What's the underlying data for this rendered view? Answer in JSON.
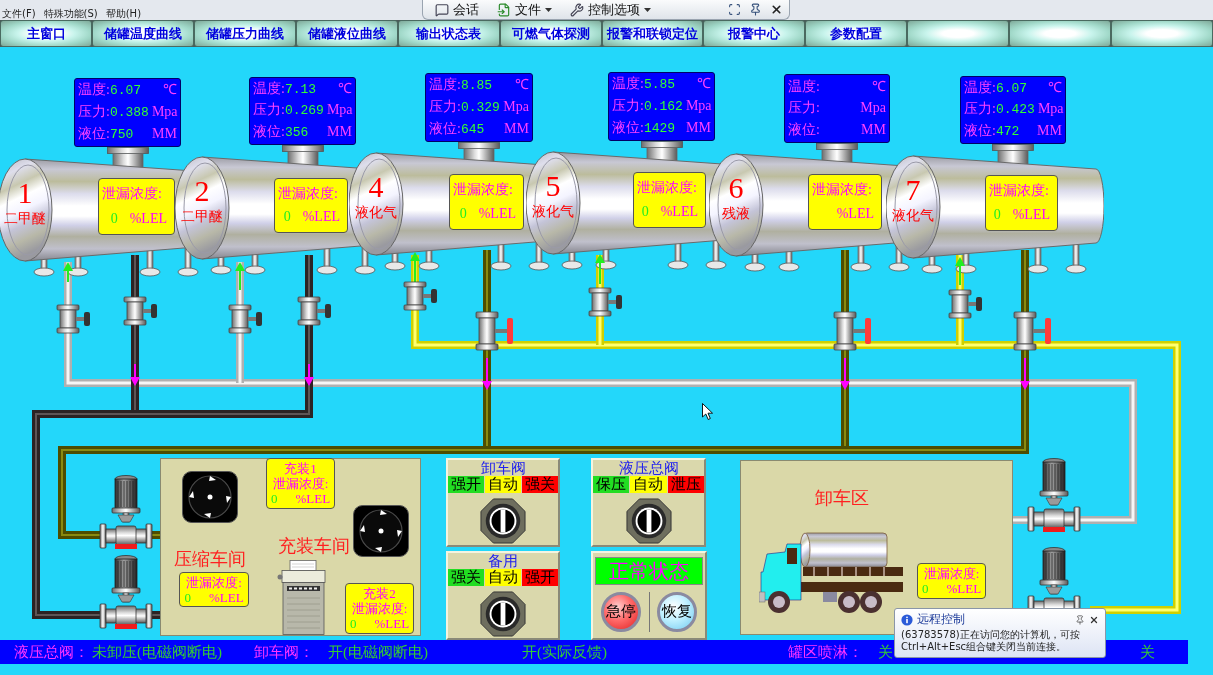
{
  "menu_bar": [
    {
      "label": "文件(F)"
    },
    {
      "label": "特殊功能(S)"
    },
    {
      "label": "帮助(H)"
    }
  ],
  "remote_toolbar": {
    "buttons": [
      {
        "kind": "chat",
        "label": "会话",
        "has_menu": false
      },
      {
        "kind": "file",
        "label": "文件",
        "has_menu": true
      },
      {
        "kind": "tools",
        "label": "控制选项",
        "has_menu": true
      }
    ]
  },
  "nav_tabs": [
    {
      "kind": "text",
      "label": "主窗口"
    },
    {
      "kind": "text",
      "label": "储罐温度曲线"
    },
    {
      "kind": "text",
      "label": "储罐压力曲线"
    },
    {
      "kind": "text",
      "label": "储罐液位曲线"
    },
    {
      "kind": "text",
      "label": "输出状态表"
    },
    {
      "kind": "text",
      "label": "可燃气体探测"
    },
    {
      "kind": "text",
      "label": "报警和联锁定位"
    },
    {
      "kind": "text",
      "label": "报警中心"
    },
    {
      "kind": "text",
      "label": "参数配置"
    },
    {
      "kind": "blank"
    },
    {
      "kind": "blank"
    },
    {
      "kind": "blank"
    }
  ],
  "tanks": [
    {
      "number": "1",
      "name": "二甲醚",
      "readings": [
        {
          "label": "温度:",
          "value": "6.07",
          "unit": "℃"
        },
        {
          "label": "压力:",
          "value": "0.388",
          "unit": "Mpa"
        },
        {
          "label": "液位:",
          "value": "750",
          "unit": "MM"
        }
      ],
      "leak": {
        "label": "泄漏浓度:",
        "value": "0",
        "unit": "%LEL"
      }
    },
    {
      "number": "2",
      "name": "二甲醚",
      "readings": [
        {
          "label": "温度:",
          "value": "7.13",
          "unit": "℃"
        },
        {
          "label": "压力:",
          "value": "0.269",
          "unit": "Mpa"
        },
        {
          "label": "液位:",
          "value": "356",
          "unit": "MM"
        }
      ],
      "leak": {
        "label": "泄漏浓度:",
        "value": "0",
        "unit": "%LEL"
      }
    },
    {
      "number": "4",
      "name": "液化气",
      "readings": [
        {
          "label": "温度:",
          "value": "8.85",
          "unit": "℃"
        },
        {
          "label": "压力:",
          "value": "0.329",
          "unit": "Mpa"
        },
        {
          "label": "液位:",
          "value": "645",
          "unit": "MM"
        }
      ],
      "leak": {
        "label": "泄漏浓度:",
        "value": "0",
        "unit": "%LEL"
      }
    },
    {
      "number": "5",
      "name": "液化气",
      "readings": [
        {
          "label": "温度:",
          "value": "5.85",
          "unit": "℃"
        },
        {
          "label": "压力:",
          "value": "0.162",
          "unit": "Mpa"
        },
        {
          "label": "液位:",
          "value": "1429",
          "unit": "MM"
        }
      ],
      "leak": {
        "label": "泄漏浓度:",
        "value": "0",
        "unit": "%LEL"
      }
    },
    {
      "number": "6",
      "name": "残液",
      "readings": [
        {
          "label": "温度:",
          "unit": "℃"
        },
        {
          "label": "压力:",
          "unit": "Mpa"
        },
        {
          "label": "液位:",
          "unit": "MM"
        }
      ],
      "leak": {
        "label": "泄漏浓度:",
        "unit": "%LEL"
      }
    },
    {
      "number": "7",
      "name": "液化气",
      "readings": [
        {
          "label": "温度:",
          "value": "6.07",
          "unit": "℃"
        },
        {
          "label": "压力:",
          "value": "0.423",
          "unit": "Mpa"
        },
        {
          "label": "液位:",
          "value": "472",
          "unit": "MM"
        }
      ],
      "leak": {
        "label": "泄漏浓度:",
        "value": "0",
        "unit": "%LEL"
      }
    }
  ],
  "workshop": {
    "compressor_title": "压缩车间",
    "filling_title": "充装车间",
    "filling_1_leak": {
      "title": "充装1",
      "label": "泄漏浓度:",
      "value": "0",
      "unit": "%LEL"
    },
    "compressor_leak": {
      "label": "泄漏浓度:",
      "value": "0",
      "unit": "%LEL"
    },
    "filling_2_leak": {
      "title": "充装2",
      "label": "泄漏浓度:",
      "value": "0",
      "unit": "%LEL"
    }
  },
  "switch_panels": [
    {
      "title": "卸车阀",
      "options": [
        {
          "label": "强开",
          "color": "#22dd22"
        },
        {
          "label": "自动",
          "color": "#ffff00"
        },
        {
          "label": "强关",
          "color": "#ff0000"
        }
      ],
      "level": 0.5
    },
    {
      "title": "备用",
      "options": [
        {
          "label": "强关",
          "color": "#22dd22"
        },
        {
          "label": "自动",
          "color": "#ffff00"
        },
        {
          "label": "强开",
          "color": "#ff0000"
        }
      ],
      "level": 0.5
    },
    {
      "title": "液压总阀",
      "options": [
        {
          "label": "保压",
          "color": "#22dd22"
        },
        {
          "label": "自动",
          "color": "#ffff00"
        },
        {
          "label": "泄压",
          "color": "#ff0000"
        }
      ],
      "level": 0.5
    }
  ],
  "status_panel": {
    "state": "正常状态",
    "buttons": [
      {
        "kind": "stop",
        "label": "急停"
      },
      {
        "kind": "reset",
        "label": "恢复"
      }
    ]
  },
  "unload_area": {
    "title": "卸车区",
    "leak": {
      "label": "泄漏浓度:",
      "value": "0",
      "unit": "%LEL"
    }
  },
  "status_bar": [
    {
      "kind": "label",
      "text": "液压总阀："
    },
    {
      "kind": "value",
      "text": "未卸压(电磁阀断电)"
    },
    {
      "kind": "label",
      "text": "卸车阀："
    },
    {
      "kind": "value",
      "text": "开(电磁阀断电)"
    },
    {
      "kind": "value",
      "text": "开(实际反馈)"
    },
    {
      "kind": "label",
      "text": "罐区喷淋："
    },
    {
      "kind": "value",
      "text": "关"
    },
    {
      "kind": "value",
      "text": "关"
    }
  ],
  "remote_notice": {
    "title": "远程控制",
    "message": "(63783578)正在访问您的计算机，可按Ctrl+Alt+Esc组合键关闭当前连接。"
  }
}
